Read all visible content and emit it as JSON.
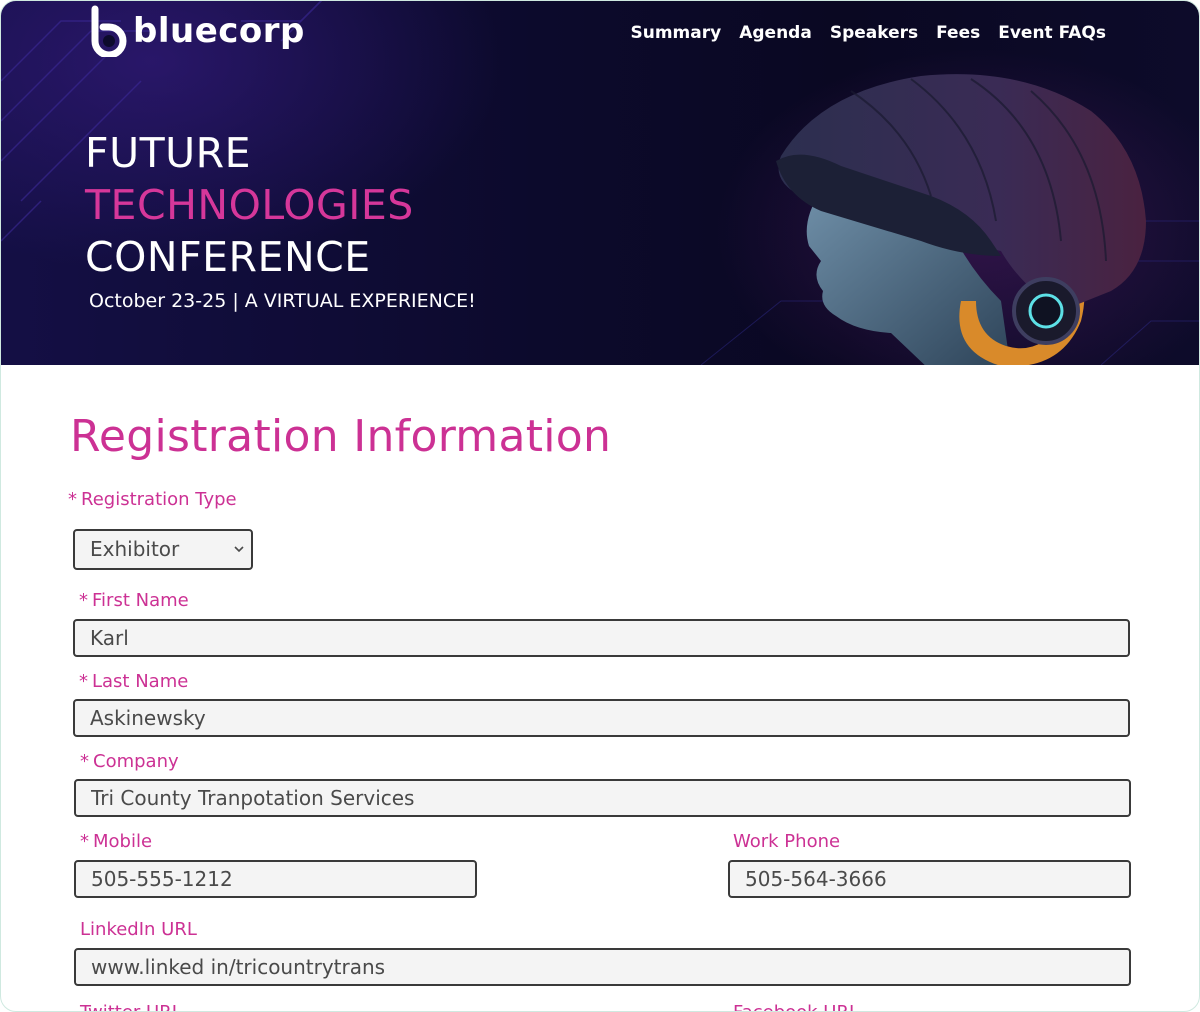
{
  "header": {
    "logo_text": "bluecorp",
    "nav": [
      "Summary",
      "Agenda",
      "Speakers",
      "Fees",
      "Event FAQs"
    ],
    "title_line1": "FUTURE",
    "title_line2": "TECHNOLOGIES",
    "title_line3": "CONFERENCE",
    "tagline": "October 23-25 | A VIRTUAL EXPERIENCE!"
  },
  "form": {
    "title": "Registration Information",
    "required_mark": "*",
    "registration_type": {
      "label": "Registration Type",
      "value": "Exhibitor",
      "required": true
    },
    "first_name": {
      "label": "First Name",
      "value": "Karl",
      "required": true
    },
    "last_name": {
      "label": "Last Name",
      "value": "Askinewsky",
      "required": true
    },
    "company": {
      "label": "Company",
      "value": "Tri County Tranpotation Services",
      "required": true
    },
    "mobile": {
      "label": "Mobile",
      "value": "505-555-1212",
      "required": true
    },
    "work_phone": {
      "label": "Work Phone",
      "value": "505-564-3666",
      "required": false
    },
    "linkedin": {
      "label": "LinkedIn URL",
      "value": "www.linked in/tricountrytrans",
      "required": false
    },
    "twitter": {
      "label": "Twitter URL"
    },
    "facebook": {
      "label": "Facebook URL"
    }
  },
  "colors": {
    "accent": "#cc3194",
    "hero_bg": "#0c0a2c",
    "field_border": "#3a3a3a",
    "field_bg": "#f4f4f4"
  },
  "icons": {
    "logo": "bluecorp-logo-icon",
    "select_chevron": "chevron-down-icon"
  }
}
